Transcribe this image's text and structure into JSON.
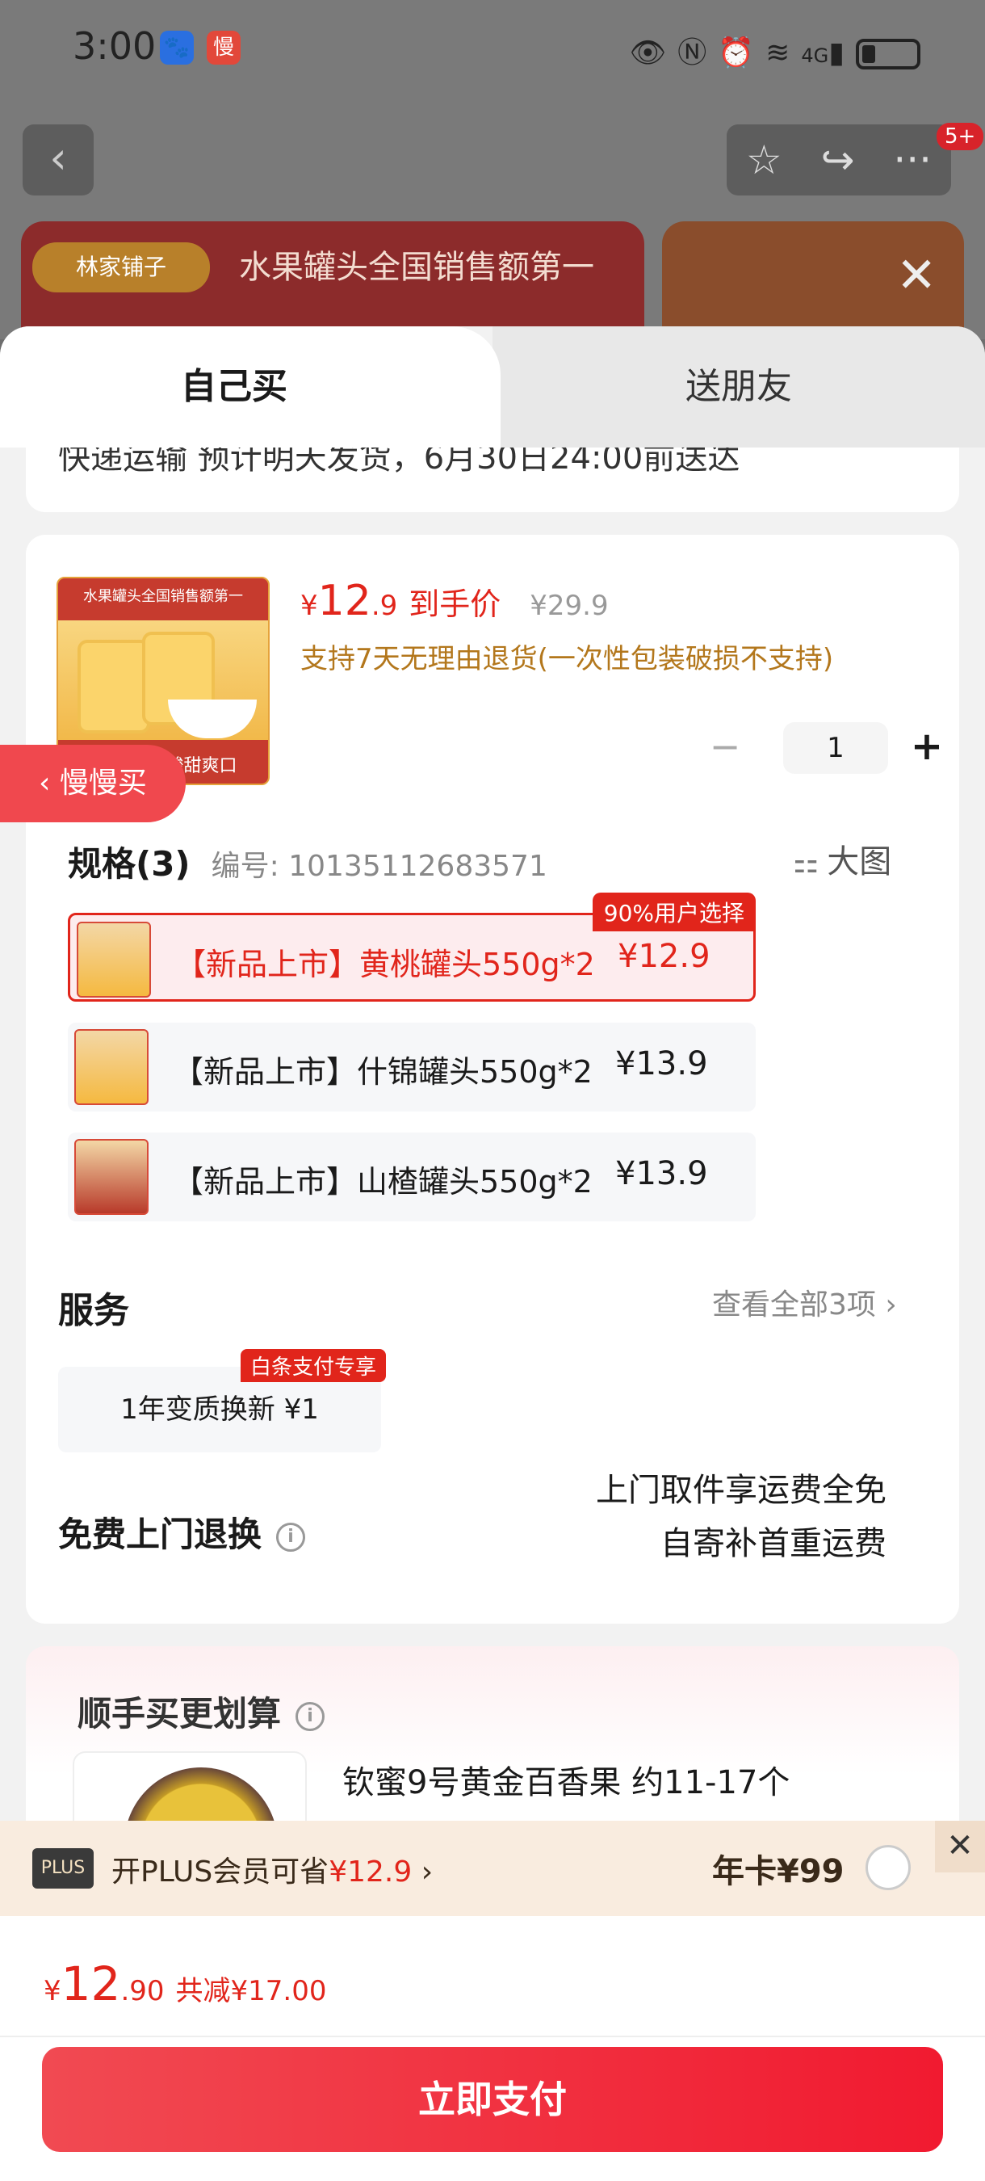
{
  "status_bar": {
    "time": "3:00",
    "app_icons": [
      "baidu-icon",
      "slow-icon"
    ],
    "app2_label": "慢",
    "signal": "4G"
  },
  "nav": {
    "badge": "5+"
  },
  "banner": {
    "brand": "林家铺子",
    "headline": "水果罐头全国销售额第一"
  },
  "tabs": {
    "self": "自己买",
    "friend": "送朋友"
  },
  "delivery_note": "快递运输 预计明天发货，6月30日24:00前送达",
  "product": {
    "image_top_text": "水果罐头全国销售额第一",
    "image_bottom_text": "果肉紧弹 酸甜爽口",
    "price_currency": "¥",
    "price_int": "12",
    "price_dec": ".9",
    "price_label": "到手价",
    "original_price": "¥29.9",
    "return_policy": "支持7天无理由退货(一次性包装破损不支持)",
    "quantity": "1"
  },
  "slow_buy": "慢慢买",
  "spec": {
    "title": "规格(3)",
    "code": "编号: 10135112683571",
    "big_image": "大图",
    "options": [
      {
        "name": "【新品上市】黄桃罐头550g*2",
        "price": "¥12.9",
        "tag": "90%用户选择",
        "selected": true
      },
      {
        "name": "【新品上市】什锦罐头550g*2",
        "price": "¥13.9",
        "selected": false
      },
      {
        "name": "【新品上市】山楂罐头550g*2",
        "price": "¥13.9",
        "selected": false
      }
    ]
  },
  "service": {
    "title": "服务",
    "more": "查看全部3项",
    "item": "1年变质换新  ¥1",
    "item_tag": "白条支付专享"
  },
  "return_service": {
    "title": "免费上门退换",
    "line1": "上门取件享运费全免",
    "line2": "自寄补首重运费"
  },
  "recommend": {
    "title": "顺手买更划算",
    "item_name": "钦蜜9号黄金百香果 约11-17个"
  },
  "plus": {
    "logo": "PLUS",
    "text_prefix": "开PLUS会员可省",
    "text_amount": "¥12.9",
    "year_card": "年卡¥99"
  },
  "bottom": {
    "currency": "¥",
    "total_int": "12",
    "total_dec": ".90",
    "savings": "共减¥17.00",
    "pay_label": "立即支付"
  },
  "colors": {
    "accent": "#e1251b",
    "gold": "#b3771c",
    "plus_bg": "#f9ecdf"
  }
}
